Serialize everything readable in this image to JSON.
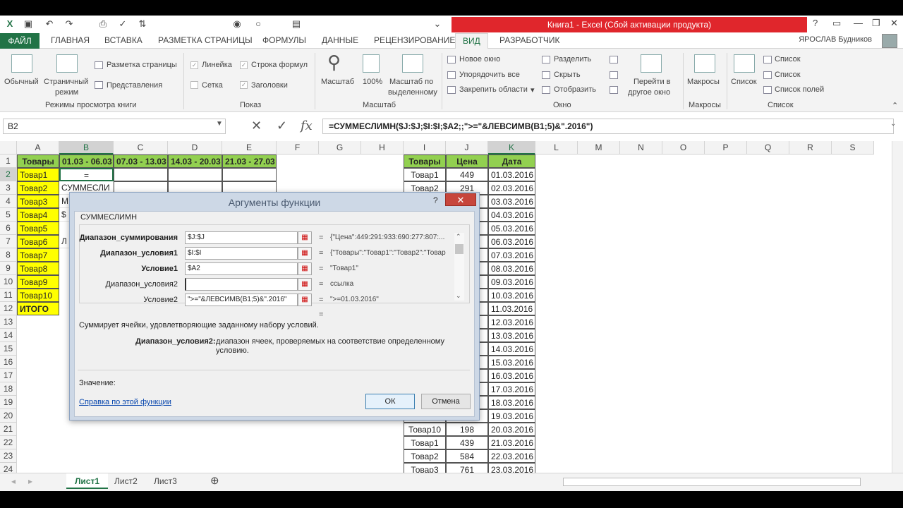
{
  "window": {
    "title": "Книга1 -  Excel (Сбой активации продукта)"
  },
  "qat": {
    "save_icon": "save-icon",
    "undo_icon": "undo-icon",
    "redo_icon": "redo-icon"
  },
  "tabs": {
    "file": "ФАЙЛ",
    "items": [
      "ГЛАВНАЯ",
      "ВСТАВКА",
      "РАЗМЕТКА СТРАНИЦЫ",
      "ФОРМУЛЫ",
      "ДАННЫЕ",
      "РЕЦЕНЗИРОВАНИЕ",
      "ВИД",
      "РАЗРАБОТЧИК"
    ],
    "active": "ВИД",
    "user": "ЯРОСЛАВ Будников"
  },
  "ribbon": {
    "views": {
      "normal": "Обычный",
      "pagebreak1": "Страничный",
      "pagebreak2": "режим",
      "layout": "Разметка страницы",
      "custom": "Представления",
      "group": "Режимы просмотра книги"
    },
    "show": {
      "ruler": "Линейка",
      "formula": "Строка формул",
      "grid": "Сетка",
      "headers": "Заголовки",
      "group": "Показ"
    },
    "zoom": {
      "zoom": "Масштаб",
      "z100": "100%",
      "sel1": "Масштаб по",
      "sel2": "выделенному",
      "group": "Масштаб"
    },
    "window": {
      "new": "Новое окно",
      "arrange": "Упорядочить все",
      "freeze": "Закрепить области",
      "split": "Разделить",
      "hide": "Скрыть",
      "unhide": "Отобразить",
      "switch1": "Перейти в",
      "switch2": "другое окно",
      "group": "Окно"
    },
    "macros": {
      "label": "Макросы",
      "group": "Макросы"
    },
    "list": {
      "list": "Список",
      "l1": "Список",
      "l2": "Список",
      "l3": "Список полей",
      "group": "Список"
    }
  },
  "formula_bar": {
    "name_box": "B2",
    "formula": "=СУММЕСЛИМН($J:$J;$I:$I;$A2;;\">=\"&ЛЕВСИМВ(B1;5)&\".2016\")"
  },
  "columns": [
    "A",
    "B",
    "C",
    "D",
    "E",
    "F",
    "G",
    "H",
    "I",
    "J",
    "K",
    "L",
    "M",
    "N",
    "O",
    "P",
    "Q",
    "R",
    "S"
  ],
  "rows": [
    "1",
    "2",
    "3",
    "4",
    "5",
    "6",
    "7",
    "8",
    "9",
    "10",
    "11",
    "12",
    "13",
    "14",
    "15",
    "16",
    "17",
    "18",
    "19",
    "20",
    "21",
    "22",
    "23",
    "24"
  ],
  "left_table": {
    "header": [
      "Товары",
      "01.03 - 06.03",
      "07.03 - 13.03",
      "14.03 - 20.03",
      "21.03 - 27.03"
    ],
    "items": [
      "Товар1",
      "Товар2",
      "Товар3",
      "Товар4",
      "Товар5",
      "Товар6",
      "Товар7",
      "Товар8",
      "Товар9",
      "Товар10",
      "ИТОГО"
    ],
    "b2": "=",
    "b3": "СУММЕСЛИ",
    "b4": "М",
    "b5": "$",
    "b7": "Л"
  },
  "right_table": {
    "header": [
      "Товары",
      "Цена",
      "Дата"
    ],
    "rows": [
      [
        "Товар1",
        "449",
        "01.03.2016"
      ],
      [
        "Товар2",
        "291",
        "02.03.2016"
      ],
      [
        "",
        "",
        "03.03.2016"
      ],
      [
        "",
        "",
        "04.03.2016"
      ],
      [
        "",
        "",
        "05.03.2016"
      ],
      [
        "",
        "",
        "06.03.2016"
      ],
      [
        "",
        "",
        "07.03.2016"
      ],
      [
        "",
        "",
        "08.03.2016"
      ],
      [
        "",
        "",
        "09.03.2016"
      ],
      [
        "",
        "",
        "10.03.2016"
      ],
      [
        "",
        "",
        "11.03.2016"
      ],
      [
        "",
        "",
        "12.03.2016"
      ],
      [
        "",
        "",
        "13.03.2016"
      ],
      [
        "",
        "",
        "14.03.2016"
      ],
      [
        "",
        "",
        "15.03.2016"
      ],
      [
        "",
        "",
        "16.03.2016"
      ],
      [
        "",
        "",
        "17.03.2016"
      ],
      [
        "",
        "",
        "18.03.2016"
      ],
      [
        "",
        "",
        "19.03.2016"
      ],
      [
        "Товар10",
        "198",
        "20.03.2016"
      ],
      [
        "Товар1",
        "439",
        "21.03.2016"
      ],
      [
        "Товар2",
        "584",
        "22.03.2016"
      ],
      [
        "Товар3",
        "761",
        "23.03.2016"
      ]
    ]
  },
  "sheets": {
    "tabs": [
      "Лист1",
      "Лист2",
      "Лист3"
    ],
    "active": "Лист1"
  },
  "dialog": {
    "title": "Аргументы функции",
    "help": "?",
    "close": "✕",
    "func": "СУММЕСЛИМН",
    "args": [
      {
        "label": "Диапазон_суммирования",
        "value": "$J:$J",
        "result": "{\"Цена\":449:291:933:690:277:807:...",
        "bold": true
      },
      {
        "label": "Диапазон_условия1",
        "value": "$I:$I",
        "result": "{\"Товары\":\"Товар1\":\"Товар2\":\"Товар",
        "bold": true
      },
      {
        "label": "Условие1",
        "value": "$A2",
        "result": "\"Товар1\"",
        "bold": true
      },
      {
        "label": "Диапазон_условия2",
        "value": "",
        "result": "ссылка",
        "bold": false
      },
      {
        "label": "Условие2",
        "value": "\">=\"&ЛЕВСИМВ(B1;5)&\".2016\"",
        "result": "\">=01.03.2016\"",
        "bold": false
      }
    ],
    "eq": "=",
    "description": "Суммирует ячейки, удовлетворяющие заданному набору условий.",
    "arg_name": "Диапазон_условия2:",
    "arg_desc": "диапазон ячеек, проверяемых на соответствие определенному условию.",
    "value_label": "Значение:",
    "help_link": "Справка по этой функции",
    "ok": "ОК",
    "cancel": "Отмена"
  }
}
